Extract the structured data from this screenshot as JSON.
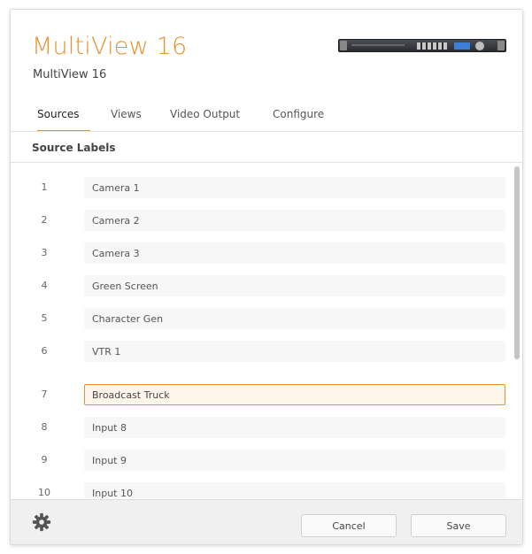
{
  "header": {
    "title": "MultiView 16",
    "subtitle": "MultiView 16",
    "device_image": "multiview-16-front-panel"
  },
  "tabs": [
    {
      "label": "Sources",
      "active": true
    },
    {
      "label": "Views",
      "active": false
    },
    {
      "label": "Video Output",
      "active": false
    },
    {
      "label": "Configure",
      "active": false
    }
  ],
  "section": {
    "title": "Source Labels"
  },
  "sources": [
    {
      "number": "1",
      "label": "Camera 1"
    },
    {
      "number": "2",
      "label": "Camera 2"
    },
    {
      "number": "3",
      "label": "Camera 3"
    },
    {
      "number": "4",
      "label": "Green Screen"
    },
    {
      "number": "5",
      "label": "Character Gen"
    },
    {
      "number": "6",
      "label": "VTR 1"
    },
    {
      "number": "7",
      "label": "Broadcast Truck",
      "focused": true
    },
    {
      "number": "8",
      "label": "Input 8"
    },
    {
      "number": "9",
      "label": "Input 9"
    },
    {
      "number": "10",
      "label": "Input 10"
    }
  ],
  "footer": {
    "settings_icon": "gear-icon",
    "cancel_label": "Cancel",
    "save_label": "Save"
  },
  "colors": {
    "accent": "#e8912e",
    "focused_field_bg": "#fff5ea",
    "field_bg": "#f7f7f7",
    "footer_bg": "#f0f0f0"
  }
}
